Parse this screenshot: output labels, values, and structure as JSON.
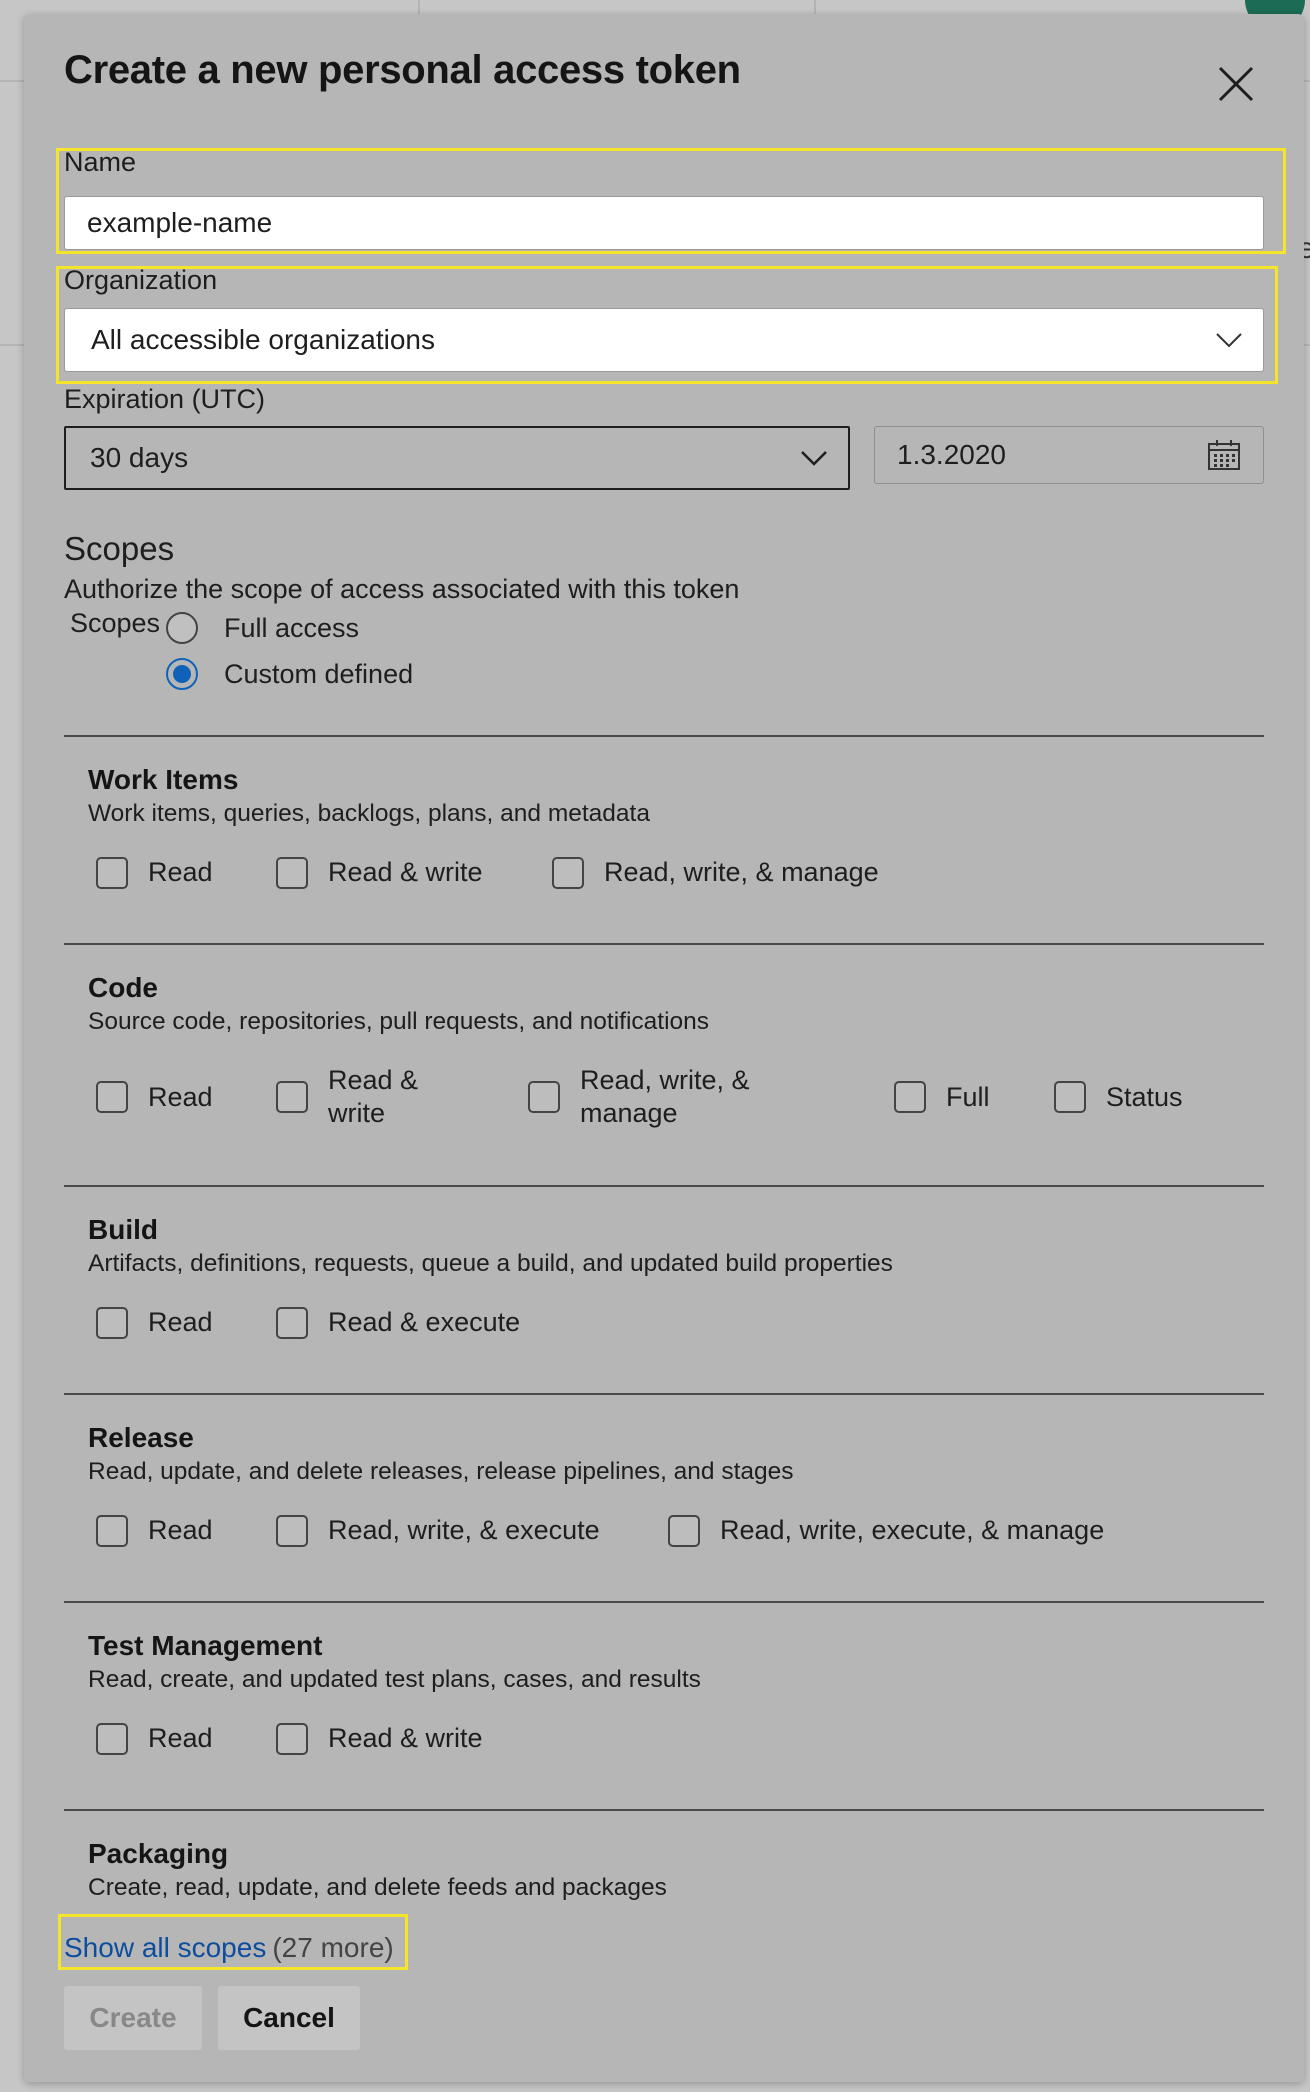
{
  "dialog": {
    "title": "Create a new personal access token",
    "close_icon": "close-icon"
  },
  "name_field": {
    "label": "Name",
    "value": "example-name"
  },
  "organization_field": {
    "label": "Organization",
    "value": "All accessible organizations"
  },
  "expiration": {
    "label": "Expiration (UTC)",
    "value": "30 days",
    "date": "1.3.2020"
  },
  "scopes": {
    "title": "Scopes",
    "description": "Authorize the scope of access associated with this token",
    "group_label": "Scopes",
    "options": [
      {
        "label": "Full access",
        "checked": false
      },
      {
        "label": "Custom defined",
        "checked": true
      }
    ]
  },
  "sections": [
    {
      "title": "Work Items",
      "description": "Work items, queries, backlogs, plans, and metadata",
      "options": [
        "Read",
        "Read & write",
        "Read, write, & manage"
      ]
    },
    {
      "title": "Code",
      "description": "Source code, repositories, pull requests, and notifications",
      "options": [
        "Read",
        "Read & write",
        "Read, write, & manage",
        "Full",
        "Status"
      ]
    },
    {
      "title": "Build",
      "description": "Artifacts, definitions, requests, queue a build, and updated build properties",
      "options": [
        "Read",
        "Read & execute"
      ]
    },
    {
      "title": "Release",
      "description": "Read, update, and delete releases, release pipelines, and stages",
      "options": [
        "Read",
        "Read, write, & execute",
        "Read, write, execute, & manage"
      ]
    },
    {
      "title": "Test Management",
      "description": "Read, create, and updated test plans, cases, and results",
      "options": [
        "Read",
        "Read & write"
      ]
    },
    {
      "title": "Packaging",
      "description": "Create, read, update, and delete feeds and packages",
      "options": []
    }
  ],
  "show_all": {
    "link": "Show all scopes",
    "more": "(27 more)"
  },
  "buttons": {
    "create": "Create",
    "cancel": "Cancel"
  },
  "background": {
    "right_edge_char": "e"
  },
  "colors": {
    "highlight": "#f5e52a",
    "link": "#0d4d9e",
    "radio_selected": "#0f62b8"
  }
}
